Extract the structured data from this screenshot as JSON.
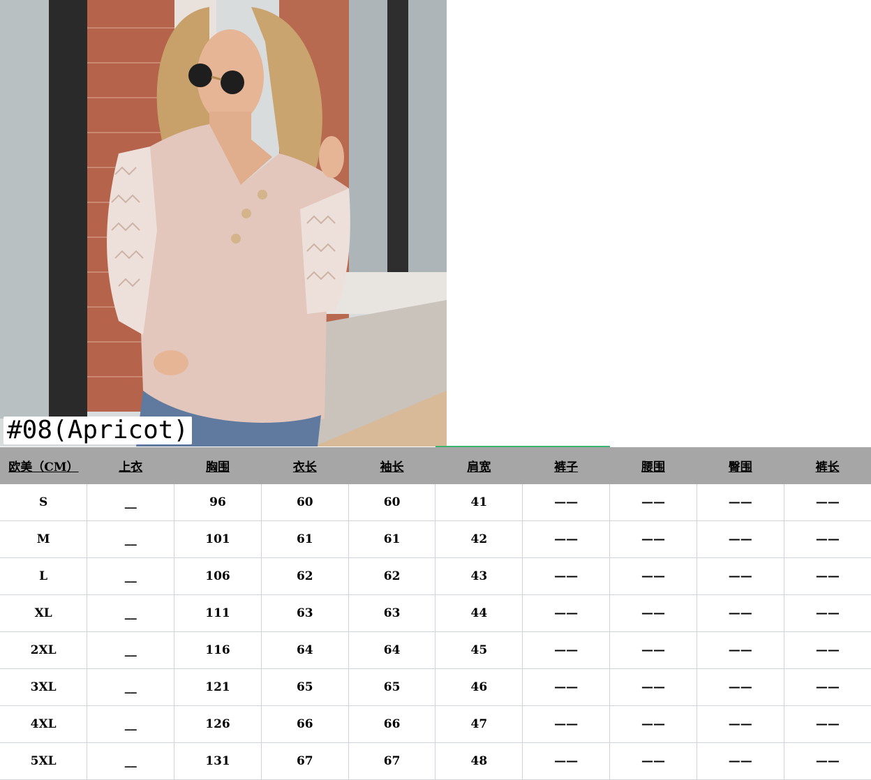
{
  "label": "#08(Apricot)",
  "table": {
    "headers": [
      "欧美（CM）",
      "上衣",
      "胸围",
      "衣长",
      "袖长",
      "肩宽",
      "裤子",
      "腰围",
      "臀围",
      "裤长"
    ],
    "rows": [
      [
        "S",
        "__",
        "96",
        "60",
        "60",
        "41",
        "——",
        "——",
        "——",
        "——"
      ],
      [
        "M",
        "__",
        "101",
        "61",
        "61",
        "42",
        "——",
        "——",
        "——",
        "——"
      ],
      [
        "L",
        "__",
        "106",
        "62",
        "62",
        "43",
        "——",
        "——",
        "——",
        "——"
      ],
      [
        "XL",
        "__",
        "111",
        "63",
        "63",
        "44",
        "——",
        "——",
        "——",
        "——"
      ],
      [
        "2XL",
        "__",
        "116",
        "64",
        "64",
        "45",
        "——",
        "——",
        "——",
        "——"
      ],
      [
        "3XL",
        "__",
        "121",
        "65",
        "65",
        "46",
        "——",
        "——",
        "——",
        "——"
      ],
      [
        "4XL",
        "__",
        "126",
        "66",
        "66",
        "47",
        "——",
        "——",
        "——",
        "——"
      ],
      [
        "5XL",
        "__",
        "131",
        "67",
        "67",
        "48",
        "——",
        "——",
        "——",
        "——"
      ]
    ]
  },
  "colors": {
    "header_bg": "#a6a6a6",
    "shirt": "#e3c7bc",
    "brick": "#b5634a"
  }
}
